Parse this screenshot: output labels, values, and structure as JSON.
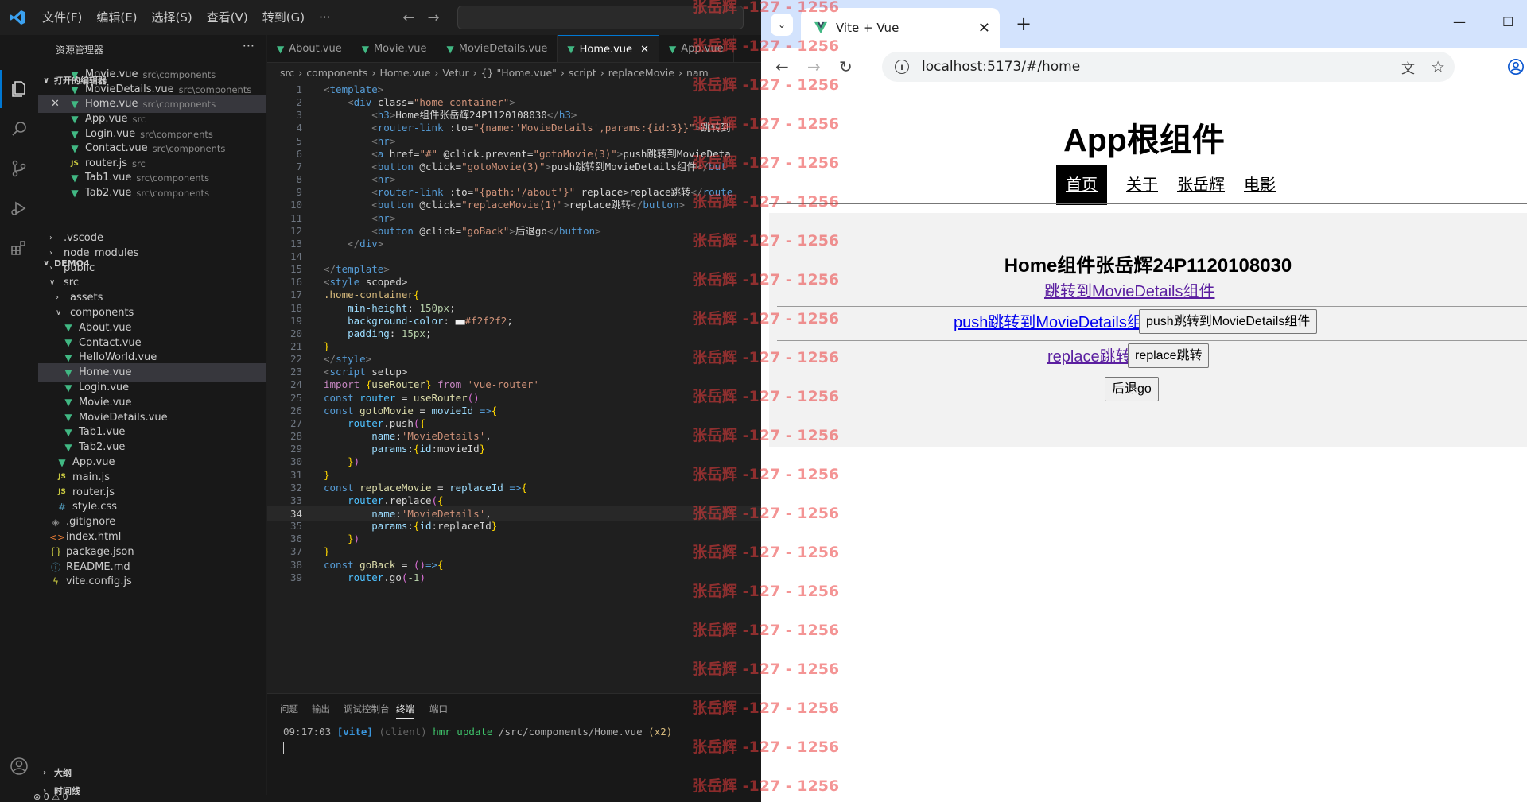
{
  "vscode": {
    "menu": [
      "文件(F)",
      "编辑(E)",
      "选择(S)",
      "查看(V)",
      "转到(G)",
      "···"
    ],
    "explorer_title": "资源管理器",
    "open_editors_title": "打开的编辑器",
    "open_editors": [
      {
        "name": "Movie.vue",
        "path": "src\\components"
      },
      {
        "name": "MovieDetails.vue",
        "path": "src\\components"
      },
      {
        "name": "Home.vue",
        "path": "src\\components"
      },
      {
        "name": "App.vue",
        "path": "src"
      },
      {
        "name": "Login.vue",
        "path": "src\\components"
      },
      {
        "name": "Contact.vue",
        "path": "src\\components"
      },
      {
        "name": "router.js",
        "path": "src"
      },
      {
        "name": "Tab1.vue",
        "path": "src\\components"
      },
      {
        "name": "Tab2.vue",
        "path": "src\\components"
      }
    ],
    "project_title": "DEMO4",
    "tree": [
      ".vscode",
      "node_modules",
      "public",
      "src",
      "assets",
      "components",
      "About.vue",
      "Contact.vue",
      "HelloWorld.vue",
      "Home.vue",
      "Login.vue",
      "Movie.vue",
      "MovieDetails.vue",
      "Tab1.vue",
      "Tab2.vue",
      "App.vue",
      "main.js",
      "router.js",
      "style.css",
      ".gitignore",
      "index.html",
      "package.json",
      "README.md",
      "vite.config.js"
    ],
    "outline_title": "大纲",
    "timeline_title": "时间线",
    "tabs": [
      "About.vue",
      "Movie.vue",
      "MovieDetails.vue",
      "Home.vue",
      "App.vue"
    ],
    "active_tab": "Home.vue",
    "breadcrumb": [
      "src",
      "components",
      "Home.vue",
      "Vetur",
      "{} \"Home.vue\"",
      "script",
      "replaceMovie",
      "nam"
    ],
    "panel_tabs": [
      "问题",
      "输出",
      "调试控制台",
      "终端",
      "端口"
    ],
    "terminal": {
      "time": "09:17:03",
      "tag": "[vite]",
      "client": "(client)",
      "msg": "hmr update",
      "path": "/src/components/Home.vue",
      "count": "(x2)"
    },
    "status": "⊗ 0 ⚠ 0",
    "code_lines": [
      "<template>",
      "    <div class=\"home-container\">",
      "        <h3>Home组件张岳辉24P1120108030</h3>",
      "        <router-link :to=\"{name:'MovieDetails',params:{id:3}}\">跳转到",
      "        <hr>",
      "        <a href=\"#\" @click.prevent=\"gotoMovie(3)\">push跳转到MovieDeta",
      "        <button @click=\"gotoMovie(3)\">push跳转到MovieDetails组件</but",
      "        <hr>",
      "        <router-link :to=\"{path:'/about'}\" replace>replace跳转</route",
      "        <button @click=\"replaceMovie(1)\">replace跳转</button>",
      "        <hr>",
      "        <button @click=\"goBack\">后退go</button>",
      "    </div>",
      "",
      "</template>",
      "<style scoped>",
      ".home-container{",
      "    min-height: 150px;",
      "    background-color: ■■#f2f2f2;",
      "    padding: 15px;",
      "}",
      "</style>",
      "<script setup>",
      "import {useRouter} from 'vue-router'",
      "const router = useRouter()",
      "const gotoMovie = movieId =>{",
      "    router.push({",
      "        name:'MovieDetails',",
      "        params:{id:movieId}",
      "    })",
      "}",
      "const replaceMovie = replaceId =>{",
      "    router.replace({",
      "        name:'MovieDetails',",
      "        params:{id:replaceId}",
      "    })",
      "}",
      "const goBack = ()=>{",
      "    router.go(-1)"
    ]
  },
  "watermark": "张岳辉 -127 - 1256",
  "browser": {
    "tab_title": "Vite + Vue",
    "url": "localhost:5173/#/home",
    "app_title": "App根组件",
    "nav": [
      "首页",
      "关于",
      "张岳辉",
      "电影"
    ],
    "home_title": "Home组件张岳辉24P1120108030",
    "link1": "跳转到MovieDetails组件",
    "link2": "push跳转到MovieDetails组件",
    "button1": "push跳转到MovieDetails组件",
    "link3": "replace跳转",
    "button2": "replace跳转",
    "button3": "后退go"
  }
}
